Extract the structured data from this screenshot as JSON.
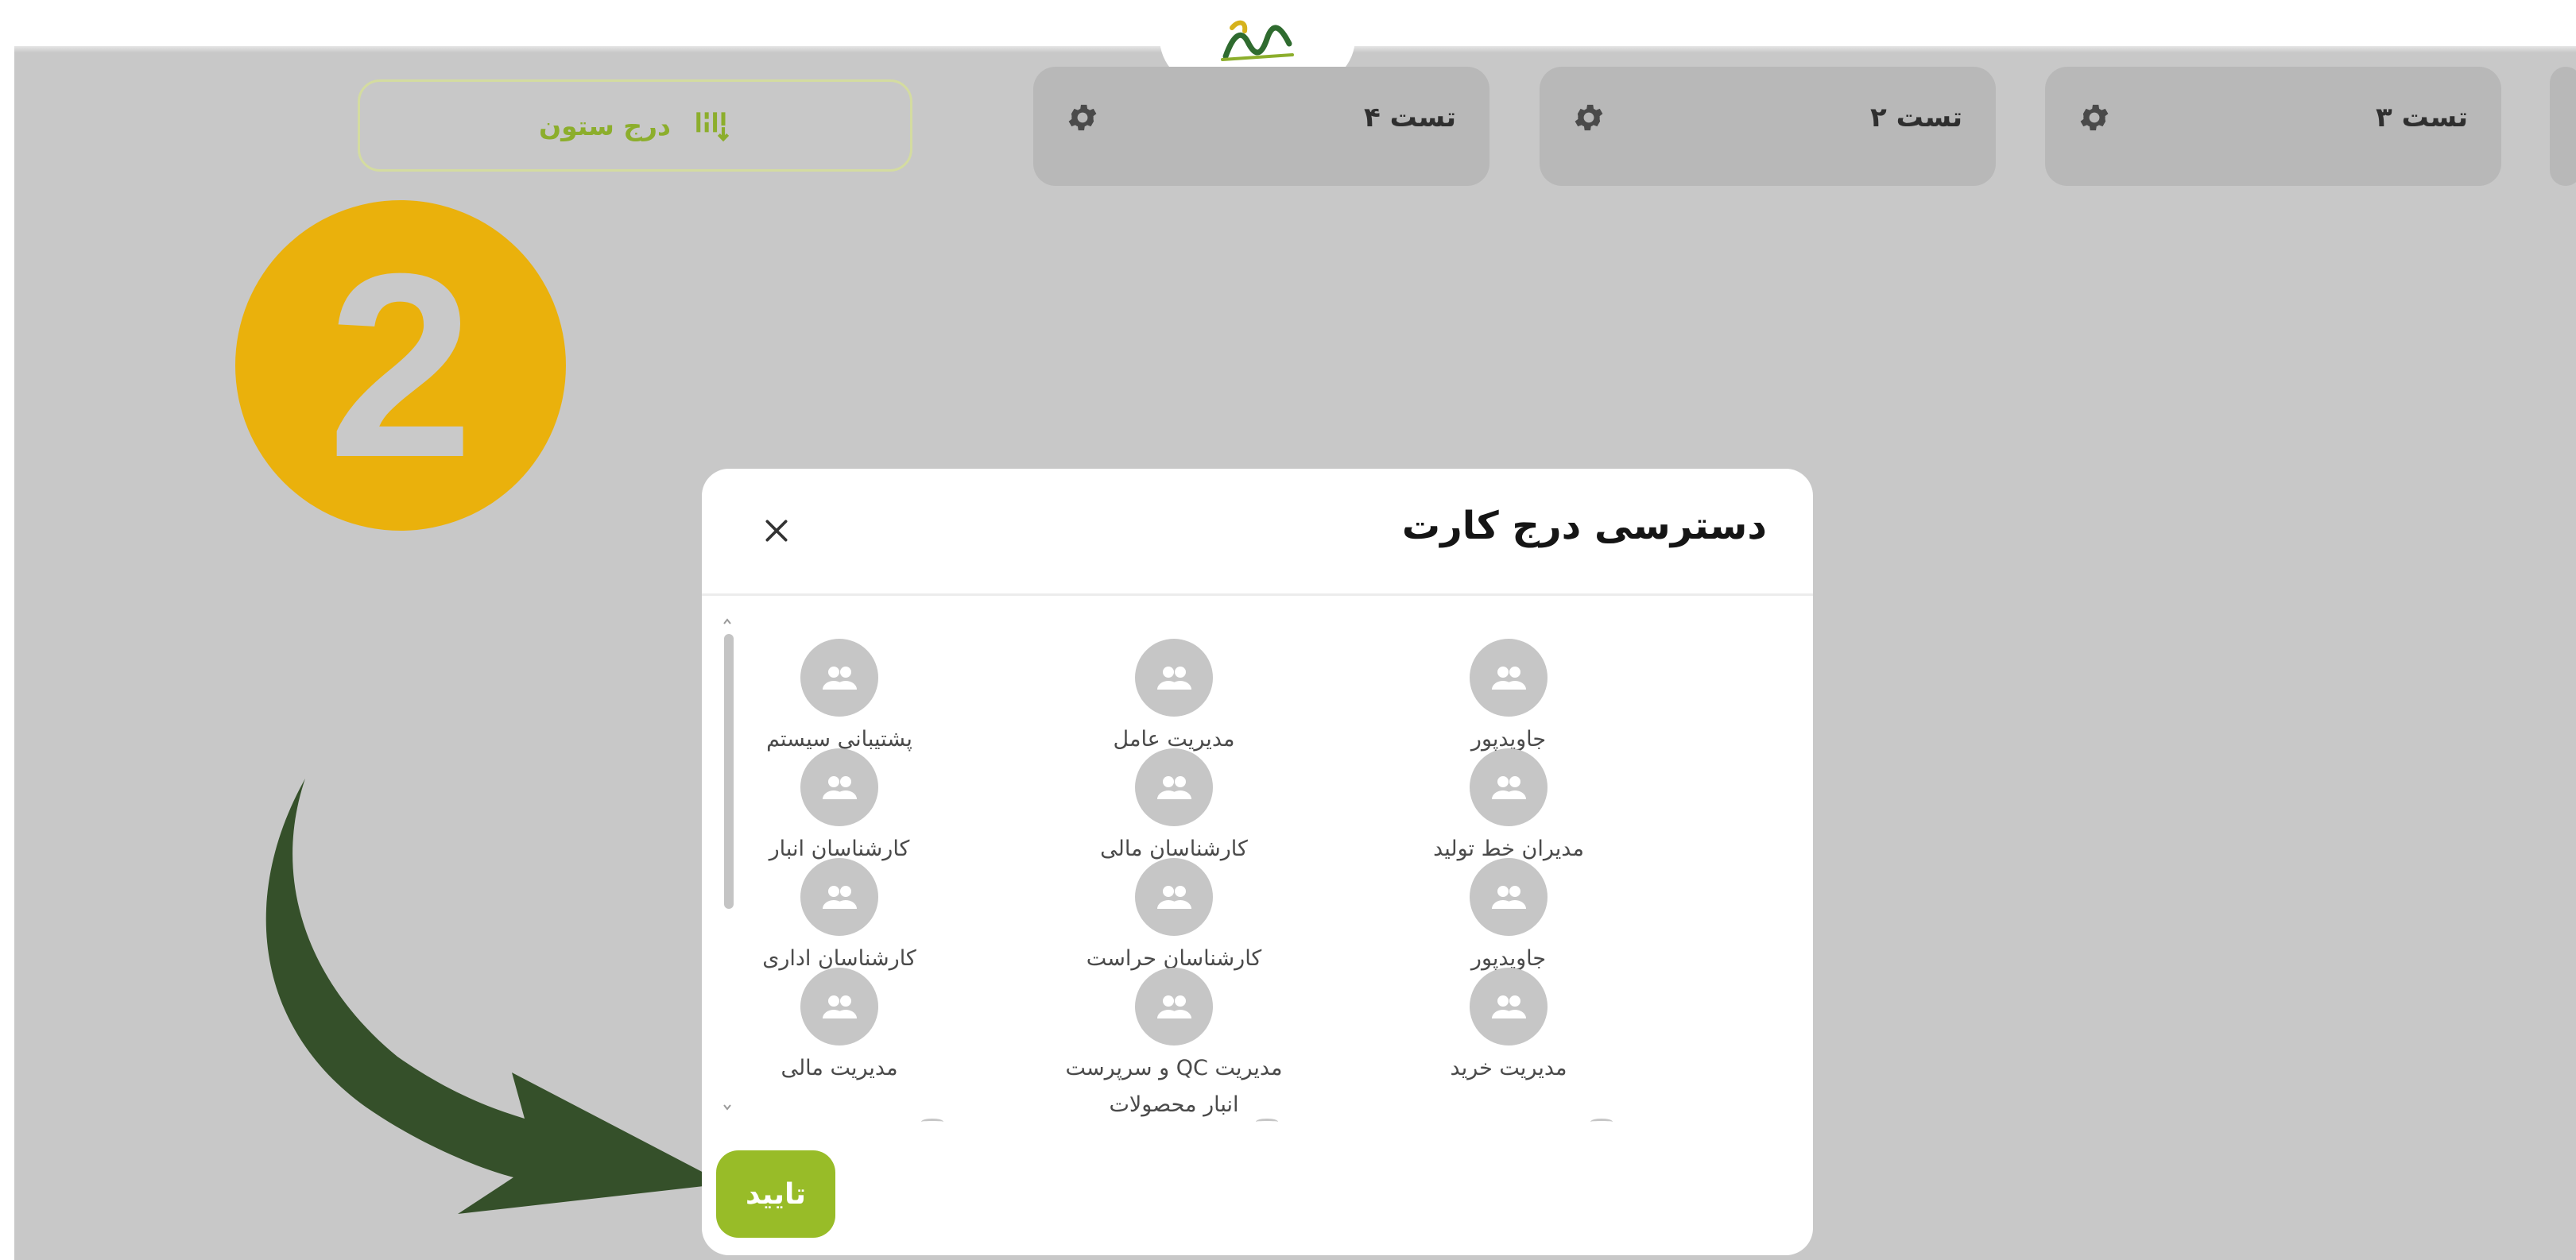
{
  "header": {
    "logo": "sin-brand-logo"
  },
  "board": {
    "add_column_label": "درج ستون",
    "columns": [
      {
        "title": "تست ۳"
      },
      {
        "title": "تست ۲"
      },
      {
        "title": "تست ۴"
      }
    ]
  },
  "annotation": {
    "step_number": "2",
    "badge_color": "#eab10c",
    "arrow_color": "#35502a"
  },
  "modal": {
    "title": "دسترسی درج کارت",
    "close_icon": "close-icon",
    "confirm_label": "تایید",
    "roles": [
      {
        "label": "جاویدپور"
      },
      {
        "label": "مدیریت عامل"
      },
      {
        "label": "پشتیبانی سیستم"
      },
      {
        "label": "مدیران خط تولید"
      },
      {
        "label": "کارشناسان مالی"
      },
      {
        "label": "کارشناسان انبار"
      },
      {
        "label": "جاویدپور"
      },
      {
        "label": "کارشناسان حراست"
      },
      {
        "label": "کارشناسان اداری"
      },
      {
        "label": "مدیریت خرید"
      },
      {
        "label": "مدیریت QC و سرپرست انبار محصولات"
      },
      {
        "label": "مدیریت مالی"
      }
    ]
  },
  "colors": {
    "accent_green": "#98bc28",
    "board_gray": "#c8c8c8",
    "column_gray": "#b8b8b8"
  }
}
